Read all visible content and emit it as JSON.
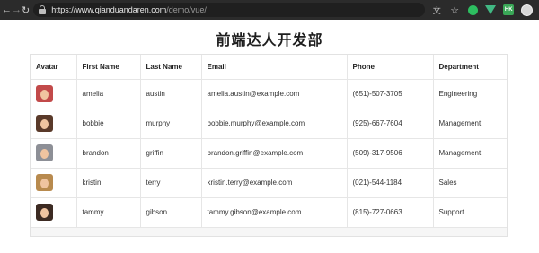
{
  "browser": {
    "url_host": "https://www.qianduandaren.com",
    "url_path": "/demo/vue/",
    "extension_badge": "HK"
  },
  "page": {
    "title": "前端达人开发部"
  },
  "table": {
    "headers": [
      "Avatar",
      "First Name",
      "Last Name",
      "Email",
      "Phone",
      "Department"
    ],
    "rows": [
      {
        "first": "amelia",
        "last": "austin",
        "email": "amelia.austin@example.com",
        "phone": "(651)-507-3705",
        "department": "Engineering",
        "avatar_bg": "#c24a4a"
      },
      {
        "first": "bobbie",
        "last": "murphy",
        "email": "bobbie.murphy@example.com",
        "phone": "(925)-667-7604",
        "department": "Management",
        "avatar_bg": "#5a3a2a"
      },
      {
        "first": "brandon",
        "last": "griffin",
        "email": "brandon.griffin@example.com",
        "phone": "(509)-317-9506",
        "department": "Management",
        "avatar_bg": "#8d8f96"
      },
      {
        "first": "kristin",
        "last": "terry",
        "email": "kristin.terry@example.com",
        "phone": "(021)-544-1184",
        "department": "Sales",
        "avatar_bg": "#b88a4e"
      },
      {
        "first": "tammy",
        "last": "gibson",
        "email": "tammy.gibson@example.com",
        "phone": "(815)-727-0663",
        "department": "Support",
        "avatar_bg": "#3c2a22"
      }
    ]
  }
}
